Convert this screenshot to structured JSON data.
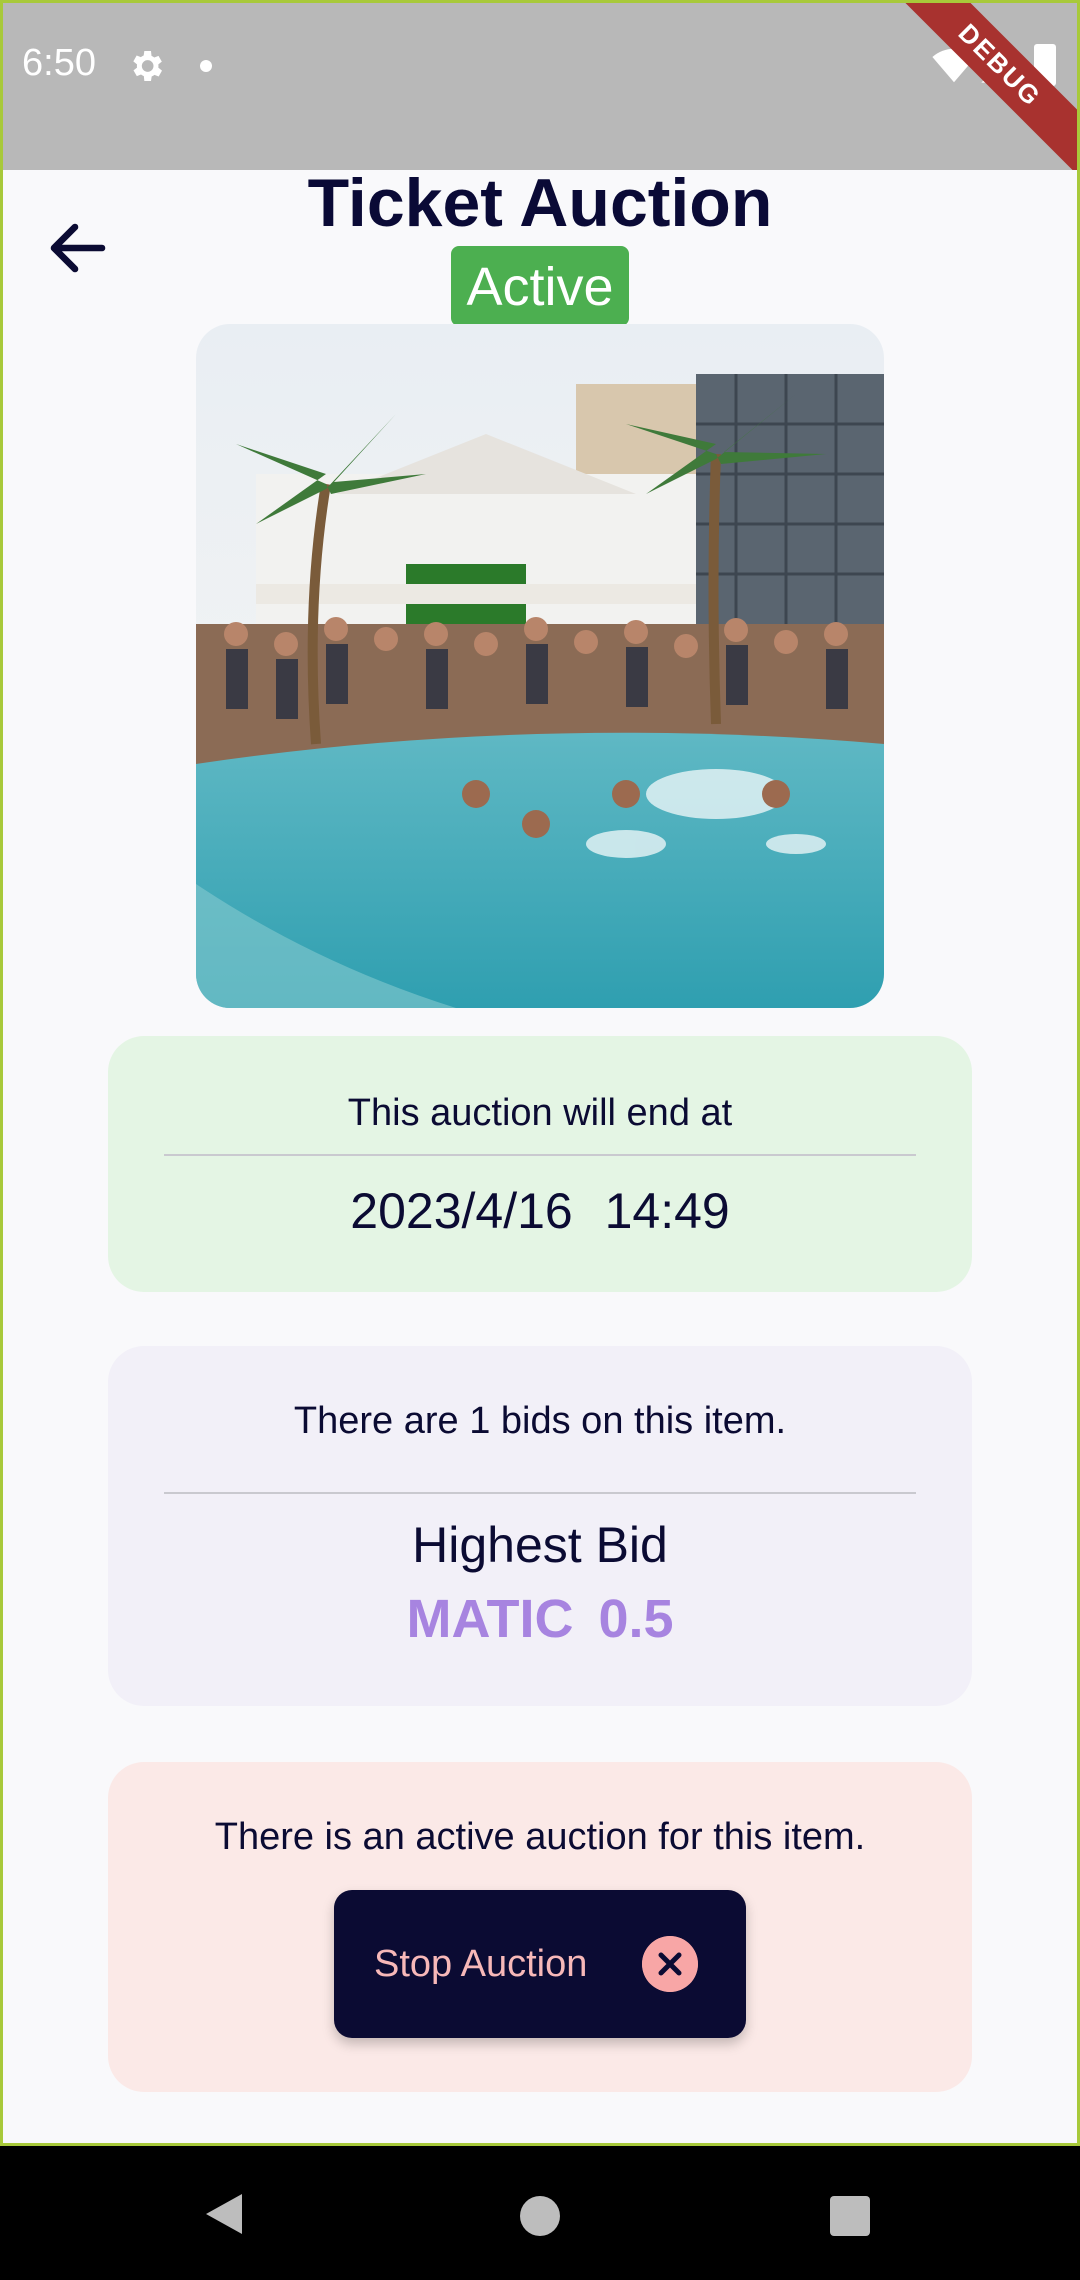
{
  "status_bar": {
    "time": "6:50",
    "debug_label": "DEBUG"
  },
  "header": {
    "title": "Ticket Auction",
    "status": "Active"
  },
  "end_card": {
    "label": "This auction will end at",
    "datetime": "2023/4/16   14:49"
  },
  "bid_card": {
    "count_text": "There are 1 bids on this item.",
    "title": "Highest Bid",
    "value": "MATIC  0.5"
  },
  "active_card": {
    "text": "There is an active auction for this item.",
    "stop_button_label": "Stop Auction"
  },
  "icons": {
    "back": "arrow-left-icon",
    "stop": "close-circle-icon",
    "settings": "gear-icon"
  },
  "colors": {
    "status_active": "#4caf50",
    "primary_dark": "#0b0b33",
    "bid_accent": "#a784e0",
    "end_card_bg": "#e4f5e4",
    "bid_card_bg": "#f2f0f8",
    "active_card_bg": "#fbe9e7"
  }
}
